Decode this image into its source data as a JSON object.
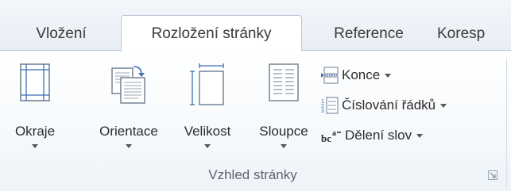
{
  "tabs": [
    "Vložení",
    "Rozložení stránky",
    "Reference",
    "Koresp"
  ],
  "active_tab": "Rozložení stránky",
  "group": {
    "label": "Vzhled stránky",
    "big_buttons": {
      "margins": "Okraje",
      "orientation": "Orientace",
      "size": "Velikost",
      "columns": "Sloupce"
    },
    "small_buttons": {
      "breaks": "Konce",
      "line_numbers": "Číslování řádků",
      "hyphenation": "Dělení slov"
    },
    "hyphenation_icon_text": "bc a-"
  },
  "colors": {
    "accent_blue": "#3b6fb6",
    "tab_border": "#b8c7da"
  }
}
